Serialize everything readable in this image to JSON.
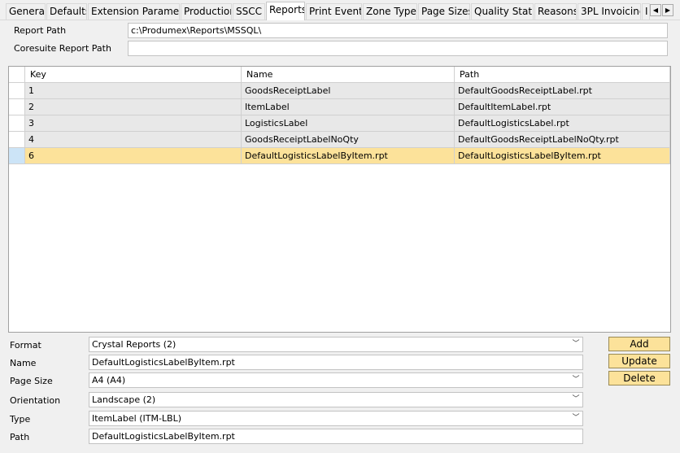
{
  "tabs": [
    {
      "label": "General"
    },
    {
      "label": "Defaults"
    },
    {
      "label": "Extension Parameter"
    },
    {
      "label": "Production"
    },
    {
      "label": "SSCC"
    },
    {
      "label": "Reports",
      "active": true
    },
    {
      "label": "Print Events"
    },
    {
      "label": "Zone Types"
    },
    {
      "label": "Page Sizes"
    },
    {
      "label": "Quality Statu"
    },
    {
      "label": "Reasons"
    },
    {
      "label": "3PL Invoicing"
    },
    {
      "label": "I"
    }
  ],
  "tab_scroll": {
    "left_icon": "◀",
    "right_icon": "▶"
  },
  "report_path": {
    "label": "Report Path",
    "value": "c:\\Produmex\\Reports\\MSSQL\\"
  },
  "coresuite_path": {
    "label": "Coresuite Report Path",
    "value": ""
  },
  "grid": {
    "columns": [
      "Key",
      "Name",
      "Path"
    ],
    "rows": [
      {
        "key": "1",
        "name": "GoodsReceiptLabel",
        "path": "DefaultGoodsReceiptLabel.rpt"
      },
      {
        "key": "2",
        "name": "ItemLabel",
        "path": "DefaultItemLabel.rpt"
      },
      {
        "key": "3",
        "name": "LogisticsLabel",
        "path": "DefaultLogisticsLabel.rpt"
      },
      {
        "key": "4",
        "name": "GoodsReceiptLabelNoQty",
        "path": "DefaultGoodsReceiptLabelNoQty.rpt"
      },
      {
        "key": "6",
        "name": "DefaultLogisticsLabelByItem.rpt",
        "path": "DefaultLogisticsLabelByItem.rpt",
        "selected": true
      }
    ]
  },
  "form": {
    "format": {
      "label": "Format",
      "value": "Crystal Reports (2)"
    },
    "name": {
      "label": "Name",
      "value": "DefaultLogisticsLabelByItem.rpt"
    },
    "page_size": {
      "label": "Page Size",
      "value": "A4 (A4)"
    },
    "orientation": {
      "label": "Orientation",
      "value": "Landscape (2)"
    },
    "type": {
      "label": "Type",
      "value": "ItemLabel (ITM-LBL)"
    },
    "path": {
      "label": "Path",
      "value": "DefaultLogisticsLabelByItem.rpt"
    }
  },
  "buttons": {
    "add": "Add",
    "update": "Update",
    "delete": "Delete"
  },
  "icons": {
    "dropdown": "chevron-down-icon",
    "dropdown_glyph": "﹀"
  },
  "colors": {
    "button_bg": "#fce29a",
    "selected_row": "#fce29a",
    "row_bg": "#e8e8e8"
  }
}
